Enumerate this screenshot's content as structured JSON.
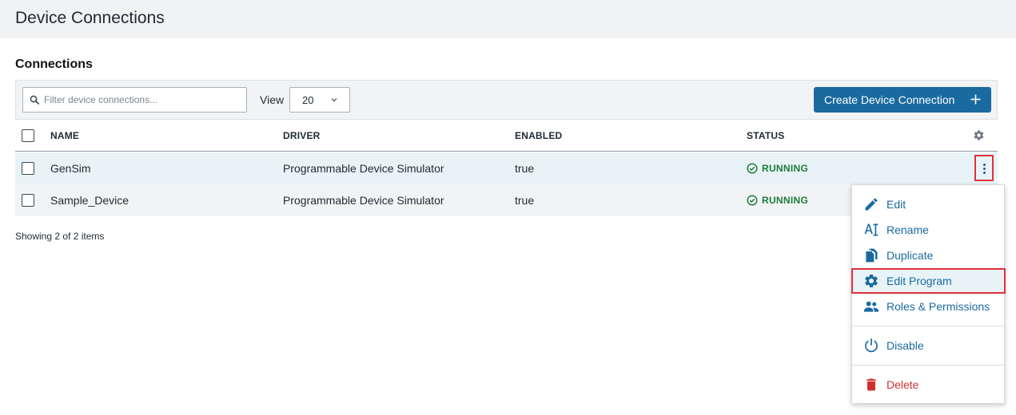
{
  "header": {
    "title": "Device Connections"
  },
  "section": {
    "title": "Connections"
  },
  "toolbar": {
    "search_placeholder": "Filter device connections...",
    "view_label": "View",
    "view_value": "20",
    "create_label": "Create Device Connection"
  },
  "table": {
    "columns": {
      "name": "NAME",
      "driver": "DRIVER",
      "enabled": "ENABLED",
      "status": "STATUS"
    },
    "rows": [
      {
        "name": "GenSim",
        "driver": "Programmable Device Simulator",
        "enabled": "true",
        "status": "RUNNING"
      },
      {
        "name": "Sample_Device",
        "driver": "Programmable Device Simulator",
        "enabled": "true",
        "status": "RUNNING"
      }
    ],
    "footer": "Showing 2 of 2 items"
  },
  "menu": {
    "items": [
      {
        "label": "Edit",
        "icon": "pencil-icon"
      },
      {
        "label": "Rename",
        "icon": "rename-icon"
      },
      {
        "label": "Duplicate",
        "icon": "duplicate-icon"
      },
      {
        "label": "Edit Program",
        "icon": "gear-icon"
      },
      {
        "label": "Roles & Permissions",
        "icon": "users-icon"
      },
      {
        "label": "Disable",
        "icon": "power-icon"
      },
      {
        "label": "Delete",
        "icon": "trash-icon"
      }
    ]
  },
  "colors": {
    "accent": "#1a6aa0",
    "running": "#1f7a3a",
    "danger": "#d32f2f",
    "highlight": "#e0303a"
  }
}
